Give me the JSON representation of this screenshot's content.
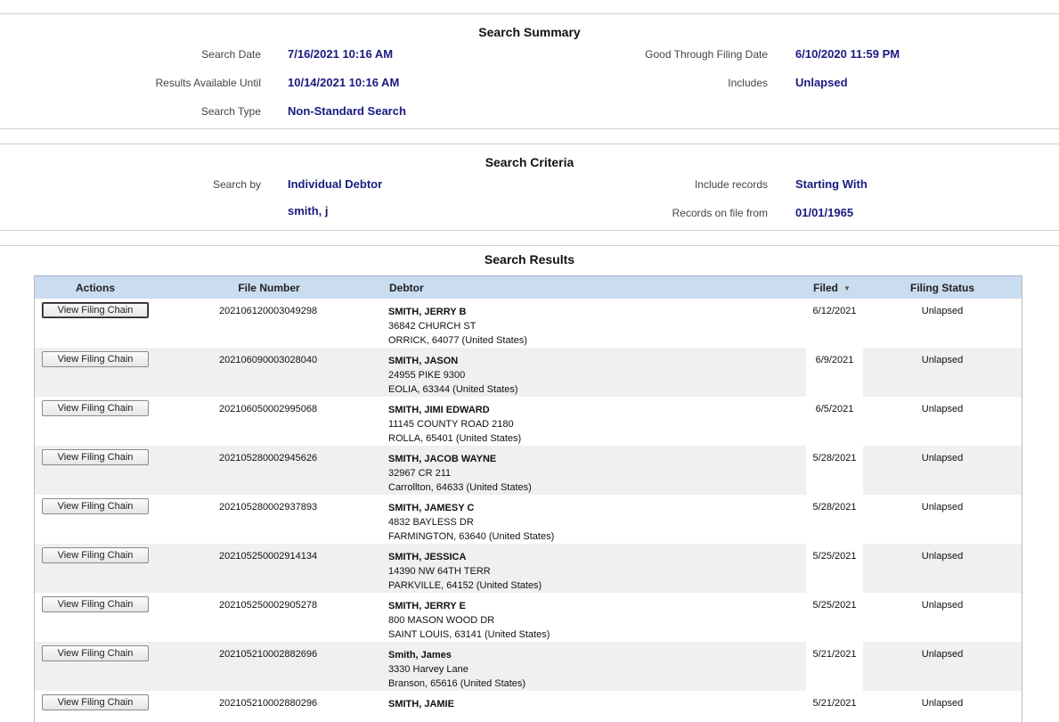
{
  "summary": {
    "title": "Search Summary",
    "search_date_label": "Search Date",
    "search_date": "7/16/2021 10:16 AM",
    "results_until_label": "Results Available Until",
    "results_until": "10/14/2021 10:16 AM",
    "search_type_label": "Search Type",
    "search_type": "Non-Standard Search",
    "good_through_label": "Good Through Filing Date",
    "good_through": "6/10/2020 11:59 PM",
    "includes_label": "Includes",
    "includes": "Unlapsed"
  },
  "criteria": {
    "title": "Search Criteria",
    "search_by_label": "Search by",
    "search_by": "Individual Debtor",
    "search_term": "smith, j",
    "include_records_label": "Include records",
    "include_records": "Starting With",
    "records_from_label": "Records on file from",
    "records_from": "01/01/1965"
  },
  "results": {
    "title": "Search Results",
    "columns": {
      "actions": "Actions",
      "file_number": "File Number",
      "debtor": "Debtor",
      "filed": "Filed",
      "status": "Filing Status"
    },
    "button_label": "View Filing Chain",
    "rows": [
      {
        "file_number": "202106120003049298",
        "name": "SMITH, JERRY B",
        "address": "36842 CHURCH ST",
        "city": "ORRICK, 64077 (United States)",
        "filed": "6/12/2021",
        "status": "Unlapsed"
      },
      {
        "file_number": "202106090003028040",
        "name": "SMITH, JASON",
        "address": "24955 PIKE 9300",
        "city": "EOLIA, 63344 (United States)",
        "filed": "6/9/2021",
        "status": "Unlapsed"
      },
      {
        "file_number": "202106050002995068",
        "name": "SMITH, JIMI EDWARD",
        "address": "11145 COUNTY ROAD 2180",
        "city": "ROLLA, 65401 (United States)",
        "filed": "6/5/2021",
        "status": "Unlapsed"
      },
      {
        "file_number": "202105280002945626",
        "name": "SMITH, JACOB WAYNE",
        "address": "32967 CR 211",
        "city": "Carrollton, 64633 (United States)",
        "filed": "5/28/2021",
        "status": "Unlapsed"
      },
      {
        "file_number": "202105280002937893",
        "name": "SMITH, JAMESY C",
        "address": "4832 BAYLESS DR",
        "city": "FARMINGTON, 63640 (United States)",
        "filed": "5/28/2021",
        "status": "Unlapsed"
      },
      {
        "file_number": "202105250002914134",
        "name": "SMITH, JESSICA",
        "address": "14390 NW 64TH TERR",
        "city": "PARKVILLE, 64152 (United States)",
        "filed": "5/25/2021",
        "status": "Unlapsed"
      },
      {
        "file_number": "202105250002905278",
        "name": "SMITH, JERRY E",
        "address": "800 MASON WOOD DR",
        "city": "SAINT LOUIS, 63141 (United States)",
        "filed": "5/25/2021",
        "status": "Unlapsed"
      },
      {
        "file_number": "202105210002882696",
        "name": "Smith, James",
        "address": "3330 Harvey Lane",
        "city": "Branson, 65616 (United States)",
        "filed": "5/21/2021",
        "status": "Unlapsed"
      },
      {
        "file_number": "202105210002880296",
        "name": "SMITH, JAMIE",
        "address": "",
        "city": "",
        "filed": "5/21/2021",
        "status": "Unlapsed"
      }
    ]
  }
}
